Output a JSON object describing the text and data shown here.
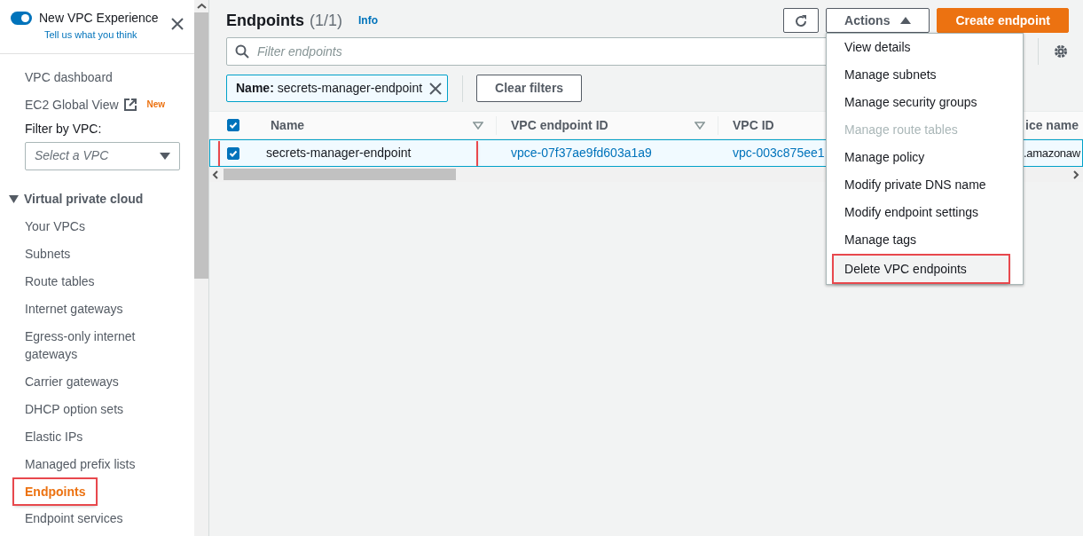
{
  "sidebar": {
    "experience_toggle": {
      "label": "New VPC Experience",
      "on": true,
      "feedback_link": "Tell us what you think"
    },
    "top_links": [
      {
        "label": "VPC dashboard",
        "external": false
      },
      {
        "label": "EC2 Global View",
        "external": true,
        "badge": "New"
      }
    ],
    "filter": {
      "label": "Filter by VPC:",
      "placeholder": "Select a VPC"
    },
    "section": {
      "title": "Virtual private cloud",
      "expanded": true,
      "items": [
        {
          "label": "Your VPCs",
          "selected": false,
          "highlighted": false
        },
        {
          "label": "Subnets",
          "selected": false,
          "highlighted": false
        },
        {
          "label": "Route tables",
          "selected": false,
          "highlighted": false
        },
        {
          "label": "Internet gateways",
          "selected": false,
          "highlighted": false
        },
        {
          "label": "Egress-only internet gateways",
          "selected": false,
          "highlighted": false
        },
        {
          "label": "Carrier gateways",
          "selected": false,
          "highlighted": false
        },
        {
          "label": "DHCP option sets",
          "selected": false,
          "highlighted": false
        },
        {
          "label": "Elastic IPs",
          "selected": false,
          "highlighted": false
        },
        {
          "label": "Managed prefix lists",
          "selected": false,
          "highlighted": false
        },
        {
          "label": "Endpoints",
          "selected": true,
          "highlighted": true
        },
        {
          "label": "Endpoint services",
          "selected": false,
          "highlighted": false
        }
      ]
    }
  },
  "header": {
    "title": "Endpoints",
    "count": "(1/1)",
    "info": "Info",
    "actions_label": "Actions",
    "create_label": "Create endpoint"
  },
  "actions_menu": {
    "expanded": true,
    "items": [
      {
        "label": "View details",
        "disabled": false,
        "highlighted": false
      },
      {
        "label": "Manage subnets",
        "disabled": false,
        "highlighted": false
      },
      {
        "label": "Manage security groups",
        "disabled": false,
        "highlighted": false
      },
      {
        "label": "Manage route tables",
        "disabled": true,
        "highlighted": false
      },
      {
        "label": "Manage policy",
        "disabled": false,
        "highlighted": false
      },
      {
        "label": "Modify private DNS name",
        "disabled": false,
        "highlighted": false
      },
      {
        "label": "Modify endpoint settings",
        "disabled": false,
        "highlighted": false
      },
      {
        "label": "Manage tags",
        "disabled": false,
        "highlighted": false
      },
      {
        "label": "Delete VPC endpoints",
        "disabled": false,
        "highlighted": true
      }
    ]
  },
  "search": {
    "placeholder": "Filter endpoints"
  },
  "filter_chip": {
    "key": "Name:",
    "value": "secrets-manager-endpoint"
  },
  "clear_filters": "Clear filters",
  "table": {
    "all_checked": true,
    "columns": [
      "Name",
      "VPC endpoint ID",
      "VPC ID",
      "ice name"
    ],
    "rows": [
      {
        "checked": true,
        "highlighted": true,
        "cells": [
          "secrets-manager-endpoint",
          "vpce-07f37ae9fd603a1a9",
          "vpc-003c875ee1",
          ".amazonaw"
        ]
      }
    ]
  }
}
